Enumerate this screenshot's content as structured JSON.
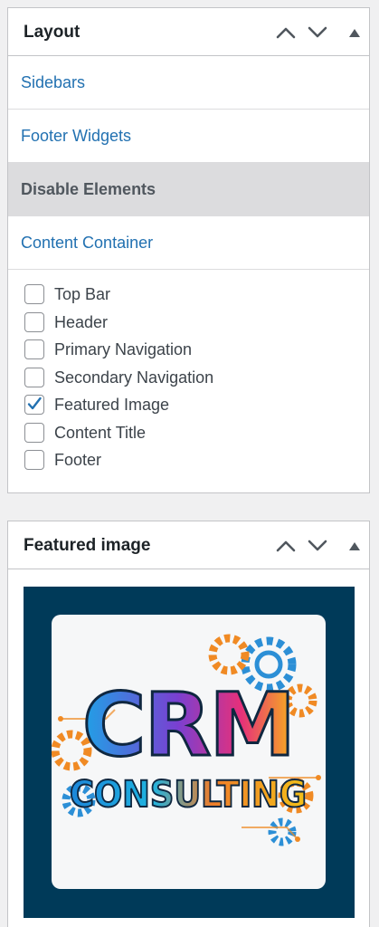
{
  "layout_panel": {
    "title": "Layout",
    "tabs": [
      {
        "label": "Sidebars"
      },
      {
        "label": "Footer Widgets"
      },
      {
        "label": "Disable Elements"
      },
      {
        "label": "Content Container"
      }
    ],
    "active_tab": "Disable Elements",
    "options": [
      {
        "label": "Top Bar",
        "checked": false
      },
      {
        "label": "Header",
        "checked": false
      },
      {
        "label": "Primary Navigation",
        "checked": false
      },
      {
        "label": "Secondary Navigation",
        "checked": false
      },
      {
        "label": "Featured Image",
        "checked": true
      },
      {
        "label": "Content Title",
        "checked": false
      },
      {
        "label": "Footer",
        "checked": false
      }
    ]
  },
  "featured_panel": {
    "title": "Featured image",
    "image": {
      "line1": "CRM",
      "line2": "CONSULTING",
      "frame_color": "#003a59"
    }
  },
  "colors": {
    "link": "#2271b1",
    "checkmark": "#2271b1",
    "active_tab_bg": "#dcdcde"
  },
  "icons": {
    "move_up": "chevron-up-icon",
    "move_down": "chevron-down-icon",
    "toggle": "triangle-up-icon"
  }
}
